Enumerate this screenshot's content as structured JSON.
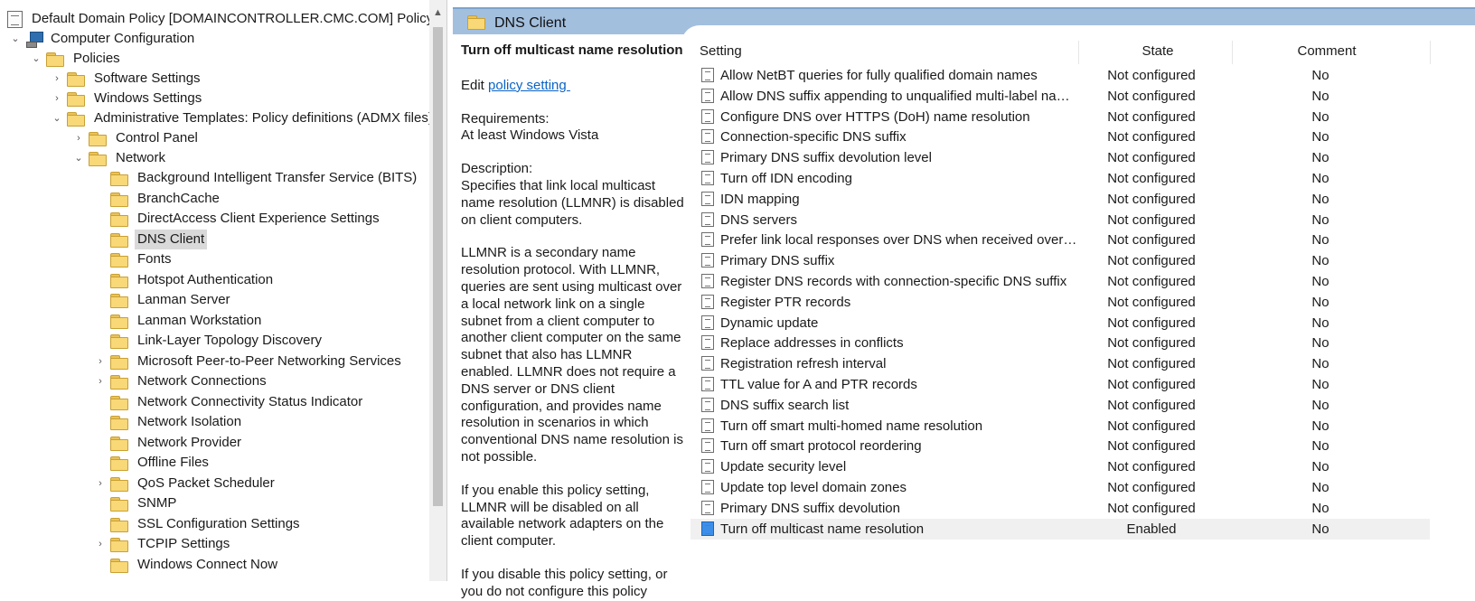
{
  "tree": {
    "root": "Default Domain Policy [DOMAINCONTROLLER.CMC.COM] Policy",
    "computer_configuration": "Computer Configuration",
    "policies": "Policies",
    "software_settings": "Software Settings",
    "windows_settings": "Windows Settings",
    "admin_templates": "Administrative Templates: Policy definitions (ADMX files) r",
    "control_panel": "Control Panel",
    "network": "Network",
    "network_children": [
      "Background Intelligent Transfer Service (BITS)",
      "BranchCache",
      "DirectAccess Client Experience Settings",
      "DNS Client",
      "Fonts",
      "Hotspot Authentication",
      "Lanman Server",
      "Lanman Workstation",
      "Link-Layer Topology Discovery",
      "Microsoft Peer-to-Peer Networking Services",
      "Network Connections",
      "Network Connectivity Status Indicator",
      "Network Isolation",
      "Network Provider",
      "Offline Files",
      "QoS Packet Scheduler",
      "SNMP",
      "SSL Configuration Settings",
      "TCPIP Settings",
      "Windows Connect Now"
    ],
    "selected": "DNS Client"
  },
  "header": {
    "title": "DNS Client"
  },
  "description": {
    "title": "Turn off multicast name resolution",
    "edit_prefix": "Edit ",
    "edit_link": "policy setting ",
    "requirements_label": "Requirements:",
    "requirements_value": "At least Windows Vista",
    "description_label": "Description:",
    "p1": "Specifies that link local multicast name resolution (LLMNR) is disabled on client computers.",
    "p2": "LLMNR is a secondary name resolution protocol. With LLMNR, queries are sent using multicast over a local network link on a single subnet from a client computer to another client computer on the same subnet that also has LLMNR enabled. LLMNR does not require a DNS server or DNS client configuration, and provides name resolution in scenarios in which conventional DNS name resolution is not possible.",
    "p3": "If you enable this policy setting, LLMNR will be disabled on all available network adapters on the client computer.",
    "p4": "If you disable this policy setting, or you do not configure this policy"
  },
  "columns": {
    "setting": "Setting",
    "state": "State",
    "comment": "Comment"
  },
  "settings": [
    {
      "name": "Allow NetBT queries for fully qualified domain names",
      "state": "Not configured",
      "comment": "No"
    },
    {
      "name": "Allow DNS suffix appending to unqualified multi-label name ...",
      "state": "Not configured",
      "comment": "No"
    },
    {
      "name": "Configure DNS over HTTPS (DoH) name resolution",
      "state": "Not configured",
      "comment": "No"
    },
    {
      "name": "Connection-specific DNS suffix",
      "state": "Not configured",
      "comment": "No"
    },
    {
      "name": "Primary DNS suffix devolution level",
      "state": "Not configured",
      "comment": "No"
    },
    {
      "name": "Turn off IDN encoding",
      "state": "Not configured",
      "comment": "No"
    },
    {
      "name": "IDN mapping",
      "state": "Not configured",
      "comment": "No"
    },
    {
      "name": "DNS servers",
      "state": "Not configured",
      "comment": "No"
    },
    {
      "name": "Prefer link local responses over DNS when received over a net...",
      "state": "Not configured",
      "comment": "No"
    },
    {
      "name": "Primary DNS suffix",
      "state": "Not configured",
      "comment": "No"
    },
    {
      "name": "Register DNS records with connection-specific DNS suffix",
      "state": "Not configured",
      "comment": "No"
    },
    {
      "name": "Register PTR records",
      "state": "Not configured",
      "comment": "No"
    },
    {
      "name": "Dynamic update",
      "state": "Not configured",
      "comment": "No"
    },
    {
      "name": "Replace addresses in conflicts",
      "state": "Not configured",
      "comment": "No"
    },
    {
      "name": "Registration refresh interval",
      "state": "Not configured",
      "comment": "No"
    },
    {
      "name": "TTL value for A and PTR records",
      "state": "Not configured",
      "comment": "No"
    },
    {
      "name": "DNS suffix search list",
      "state": "Not configured",
      "comment": "No"
    },
    {
      "name": "Turn off smart multi-homed name resolution",
      "state": "Not configured",
      "comment": "No"
    },
    {
      "name": "Turn off smart protocol reordering",
      "state": "Not configured",
      "comment": "No"
    },
    {
      "name": "Update security level",
      "state": "Not configured",
      "comment": "No"
    },
    {
      "name": "Update top level domain zones",
      "state": "Not configured",
      "comment": "No"
    },
    {
      "name": "Primary DNS suffix devolution",
      "state": "Not configured",
      "comment": "No"
    },
    {
      "name": "Turn off multicast name resolution",
      "state": "Enabled",
      "comment": "No"
    }
  ]
}
